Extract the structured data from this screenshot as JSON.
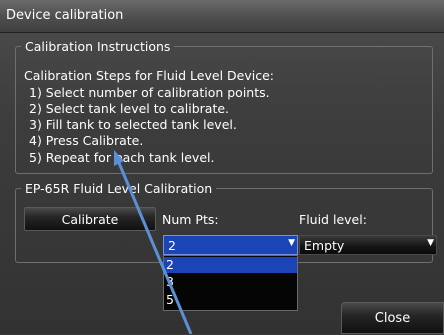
{
  "window": {
    "title": "Device calibration"
  },
  "instructions": {
    "legend": "Calibration Instructions",
    "heading": "Calibration Steps for Fluid Level Device:",
    "steps": [
      "1) Select number of calibration points.",
      "2) Select tank level to calibrate.",
      "3) Fill tank to selected tank level.",
      "4) Press Calibrate.",
      "5) Repeat for each tank level."
    ]
  },
  "calibration": {
    "legend": "EP-65R Fluid Level Calibration",
    "calibrate_label": "Calibrate",
    "num_pts_label": "Num Pts:",
    "num_pts_value": "2",
    "num_pts_options": [
      "2",
      "3",
      "5"
    ],
    "fluid_level_label": "Fluid level:",
    "fluid_level_value": "Empty"
  },
  "close_label": "Close",
  "colors": {
    "selection_blue": "#1b44b6",
    "annotation_arrow": "#5b8fd6"
  },
  "icons": {
    "dropdown_arrow": "chevron-down-icon",
    "annotation": "pointer-arrow-icon"
  }
}
